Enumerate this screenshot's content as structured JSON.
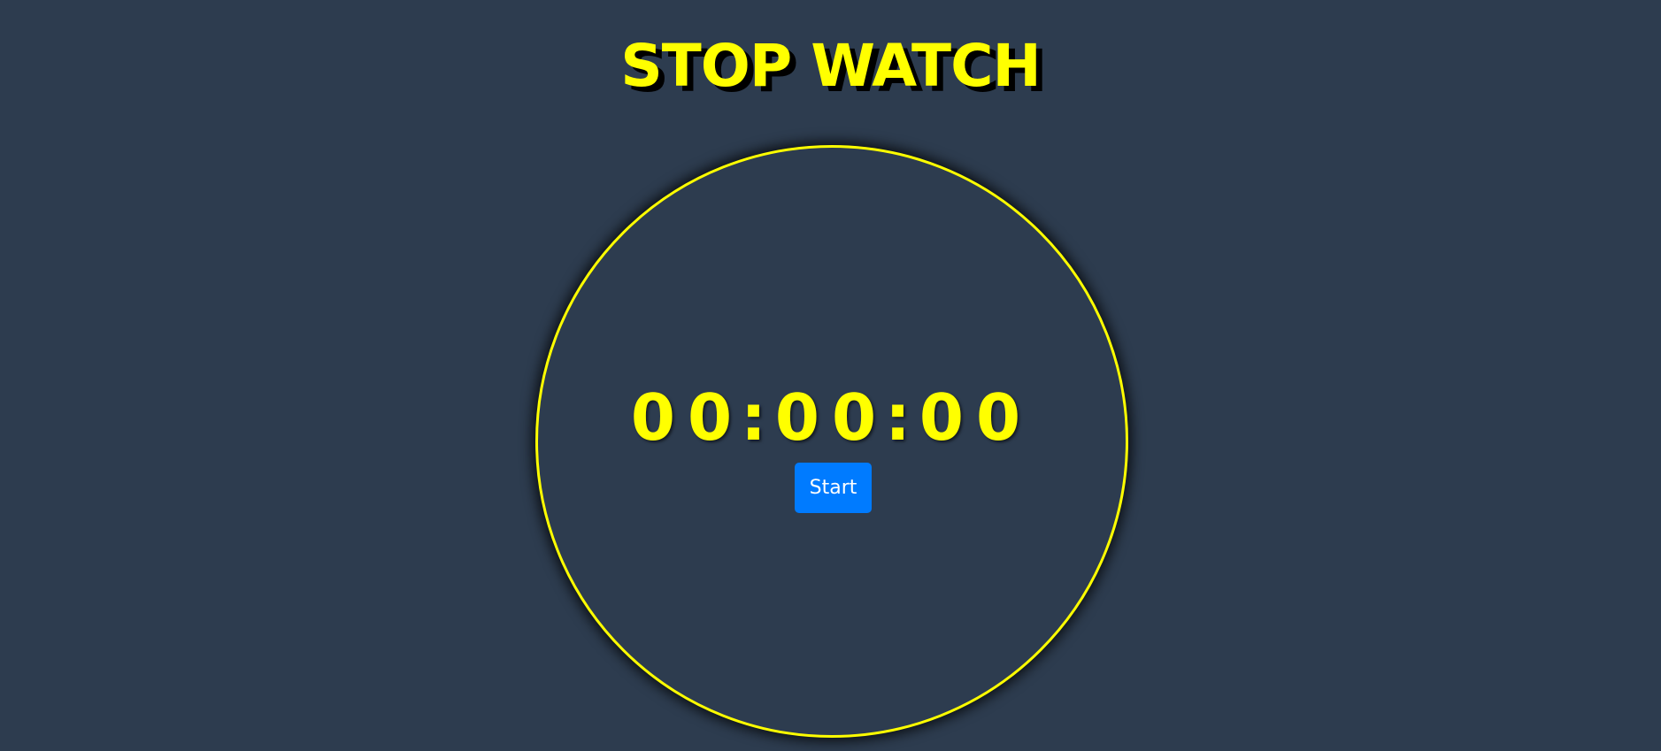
{
  "title": "STOP WATCH",
  "timer": {
    "hours": "00",
    "minutes": "00",
    "seconds": "00",
    "separator": ":"
  },
  "controls": {
    "start_label": "Start"
  },
  "colors": {
    "background": "#2d3c4f",
    "accent": "#ffff00",
    "button": "#007bff",
    "button_text": "#ffffff"
  }
}
